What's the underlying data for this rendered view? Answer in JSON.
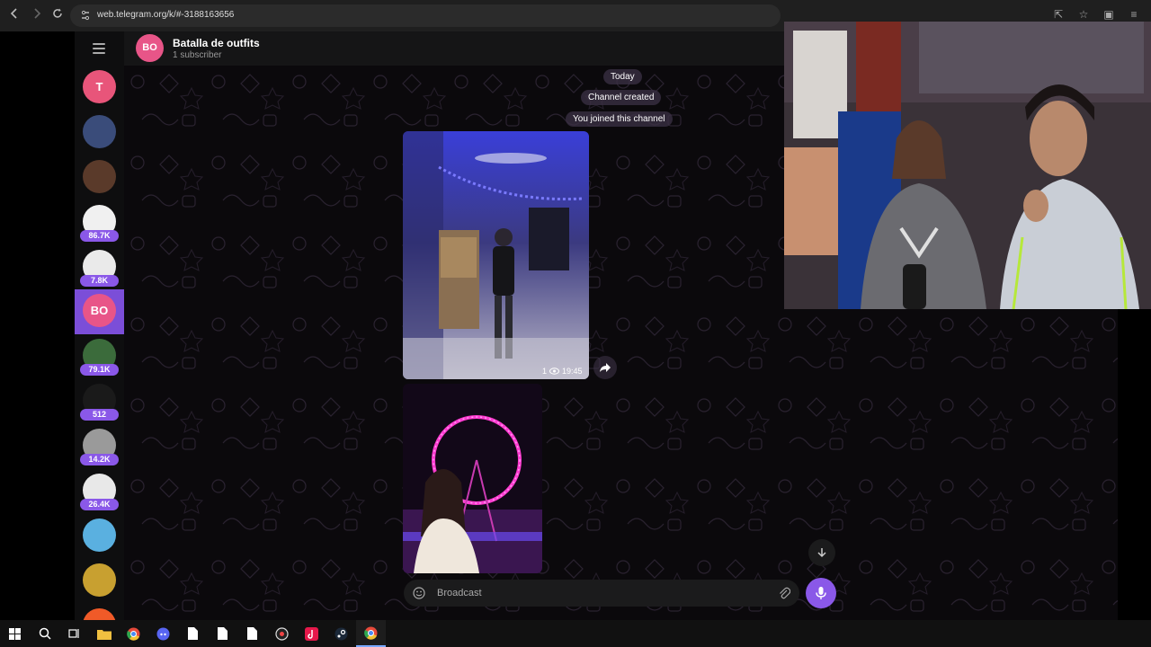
{
  "browser": {
    "url": "web.telegram.org/k/#-3188163656",
    "back_icon": "arrow-left-icon",
    "forward_icon": "arrow-right-icon",
    "reload_icon": "reload-icon"
  },
  "sidebar": {
    "items": [
      {
        "initial": "T",
        "color": "#e8557a",
        "badge": ""
      },
      {
        "initial": "",
        "color": "#3a4c7a",
        "badge": ""
      },
      {
        "initial": "",
        "color": "#5a3a2a",
        "badge": ""
      },
      {
        "initial": "",
        "color": "#f0f0f0",
        "badge": "86.7K"
      },
      {
        "initial": "",
        "color": "#eaeaea",
        "badge": "7.8K"
      },
      {
        "initial": "BO",
        "color": "#e85588",
        "badge": ""
      },
      {
        "initial": "",
        "color": "#3b6b3b",
        "badge": "79.1K"
      },
      {
        "initial": "",
        "color": "#1a1a1a",
        "badge": "512"
      },
      {
        "initial": "",
        "color": "#9a9a9a",
        "badge": "14.2K"
      },
      {
        "initial": "",
        "color": "#e8e8e8",
        "badge": "26.4K"
      },
      {
        "initial": "",
        "color": "#5ab0e0",
        "badge": ""
      },
      {
        "initial": "",
        "color": "#c8a030",
        "badge": ""
      },
      {
        "initial": "",
        "color": "#f05a28",
        "badge": ""
      }
    ]
  },
  "header": {
    "avatar_initials": "BO",
    "title": "Batalla de outfits",
    "subtitle": "1 subscriber"
  },
  "messages": {
    "date_label": "Today",
    "service_1": "Channel created",
    "service_2": "You joined this channel",
    "video_views": "1",
    "video_time": "19:45"
  },
  "composer": {
    "placeholder": "Broadcast"
  },
  "colors": {
    "accent": "#8a58e8",
    "channel_avatar": "#e85588"
  }
}
